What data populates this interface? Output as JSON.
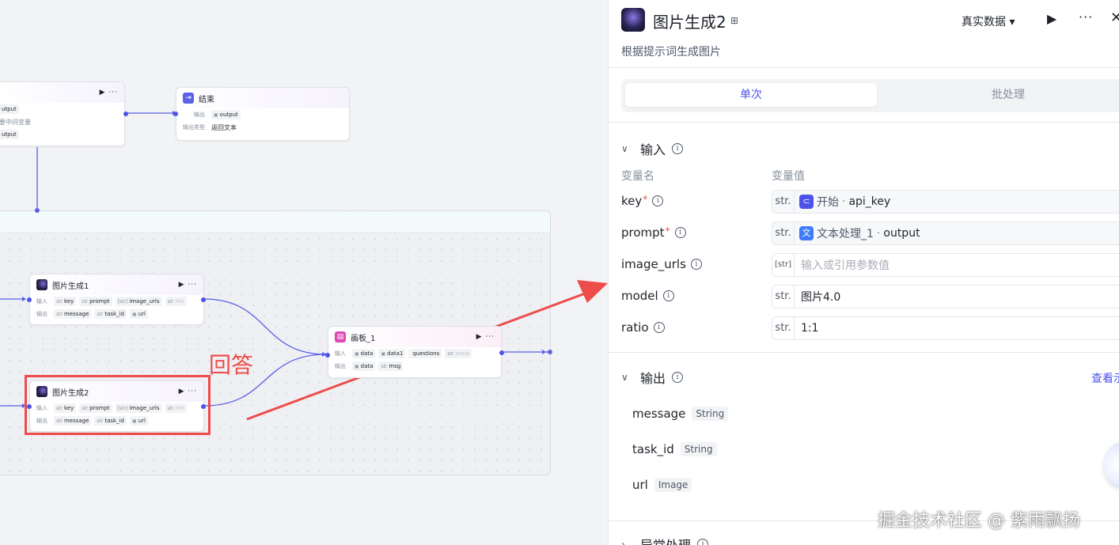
{
  "canvas": {
    "top_node": {
      "rows": [
        "utput",
        "要中间变量",
        "utput"
      ]
    },
    "end_node": {
      "title": "结束",
      "output_label": "输出",
      "output_value": "output",
      "type_label": "输出类型",
      "type_value": "返回文本"
    },
    "img_node_1": {
      "title": "图片生成1",
      "in_label": "输入",
      "out_label": "输出",
      "inputs": [
        {
          "t": "str",
          "v": "key"
        },
        {
          "t": "str",
          "v": "prompt"
        },
        {
          "t": "[str]",
          "v": "image_urls"
        },
        {
          "t": "str",
          "v": "mo"
        }
      ],
      "outputs": [
        {
          "t": "str",
          "v": "message"
        },
        {
          "t": "str",
          "v": "task_id"
        },
        {
          "t": "▣",
          "v": "url"
        }
      ]
    },
    "img_node_2": {
      "title": "图片生成2",
      "in_label": "输入",
      "out_label": "输出",
      "inputs": [
        {
          "t": "str",
          "v": "key"
        },
        {
          "t": "str",
          "v": "prompt"
        },
        {
          "t": "[str]",
          "v": "image_urls"
        },
        {
          "t": "str",
          "v": "mo"
        }
      ],
      "outputs": [
        {
          "t": "str",
          "v": "message"
        },
        {
          "t": "str",
          "v": "task_id"
        },
        {
          "t": "▣",
          "v": "url"
        }
      ]
    },
    "board_node": {
      "title": "画板_1",
      "in_label": "输入",
      "out_label": "输出",
      "inputs": [
        {
          "t": "▣",
          "v": "data"
        },
        {
          "t": "▣",
          "v": "data1"
        },
        {
          "t": "",
          "v": "questions"
        },
        {
          "t": "str",
          "v": "answ"
        }
      ],
      "outputs": [
        {
          "t": "▣",
          "v": "data"
        },
        {
          "t": "str",
          "v": "msg"
        }
      ]
    },
    "annotation": "回答",
    "node_controls": "▶ ···"
  },
  "panel": {
    "title": "图片生成2",
    "description": "根据提示词生成图片",
    "data_mode": "真实数据 ▾",
    "run_icon": "▶",
    "more_icon": "···",
    "close_icon": "✕",
    "store_icon": "⊞",
    "tabs": [
      {
        "label": "单次",
        "active": true
      },
      {
        "label": "批处理",
        "active": false
      }
    ],
    "input_section": {
      "title": "输入",
      "col_name": "变量名",
      "col_value": "变量值",
      "params": [
        {
          "name": "key",
          "required": true,
          "type": "str.",
          "ref_node": "开始",
          "ref_var": "api_key",
          "placeholder": ""
        },
        {
          "name": "prompt",
          "required": true,
          "type": "str.",
          "ref_node": "文本处理_1",
          "ref_var": "output",
          "placeholder": ""
        },
        {
          "name": "image_urls",
          "required": false,
          "type": "[str]",
          "value": "",
          "placeholder": "输入或引用参数值"
        },
        {
          "name": "model",
          "required": false,
          "type": "str.",
          "value": "图片4.0"
        },
        {
          "name": "ratio",
          "required": false,
          "type": "str.",
          "value": "1:1"
        }
      ]
    },
    "output_section": {
      "title": "输出",
      "view_link": "查看示",
      "outputs": [
        {
          "name": "message",
          "type": "String"
        },
        {
          "name": "task_id",
          "type": "String"
        },
        {
          "name": "url",
          "type": "Image"
        }
      ]
    },
    "error_section": {
      "title": "异常处理"
    },
    "watermark": "掘金技术社区 @ 紫雨飘扬"
  },
  "colors": {
    "accent": "#4d53e8",
    "annotation_red": "#ee4b4b"
  }
}
